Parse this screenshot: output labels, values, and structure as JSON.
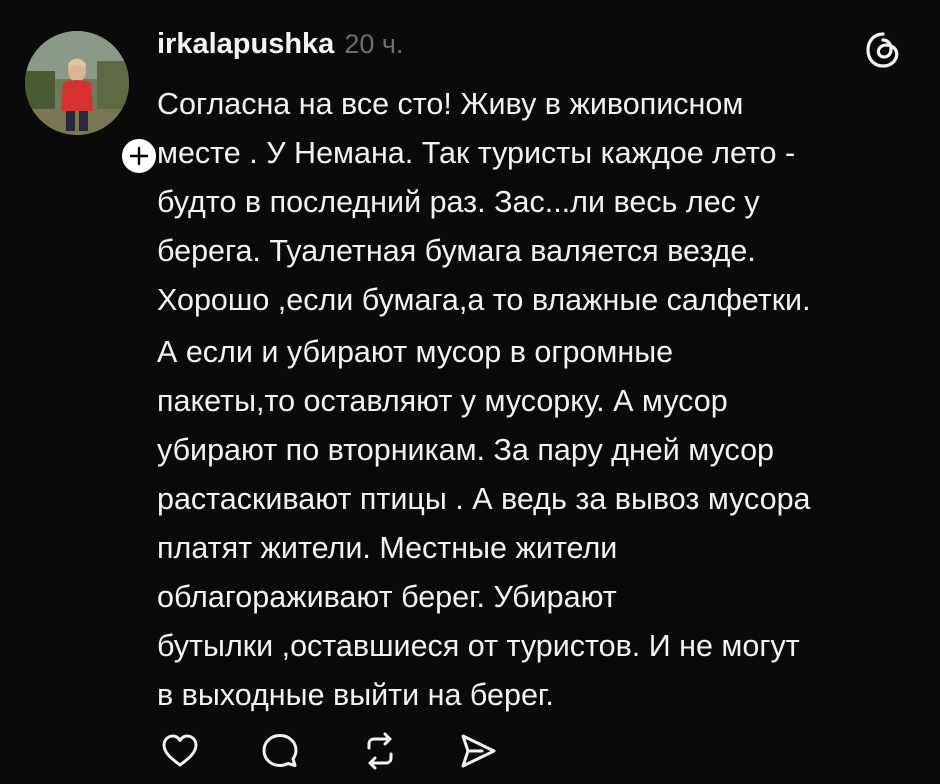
{
  "post": {
    "username": "irkalapushka",
    "timestamp": "20 ч.",
    "paragraphs": [
      {
        "lines": [
          "Согласна на все сто! Живу в живописном",
          "месте . У Немана. Так туристы каждое лето -",
          "будто в последний раз. Зас...ли весь лес у",
          "берега. Туалетная бумага валяется везде.",
          "Хорошо ,если бумага,а то влажные салфетки."
        ]
      },
      {
        "lines": [
          "А если и убирают мусор в огромные",
          "пакеты,то оставляют у мусорку. А мусор",
          "убирают по вторникам. За пару дней мусор",
          "растаскивают птицы . А ведь за вывоз мусора",
          "платят жители. Местные жители",
          "облагораживают берег. Убирают",
          "бутылки ,оставшиеся от туристов. И не могут",
          "в выходные выйти на берег."
        ]
      }
    ]
  },
  "icons": {
    "avatar": "avatar-photo",
    "follow": "plus-icon",
    "app_logo": "threads-logo-icon",
    "like": "heart-icon",
    "reply": "comment-icon",
    "repost": "repost-icon",
    "share": "send-icon"
  },
  "colors": {
    "background": "#0a0a0a",
    "text": "#f3f3f3",
    "muted": "#6f6f6f"
  }
}
